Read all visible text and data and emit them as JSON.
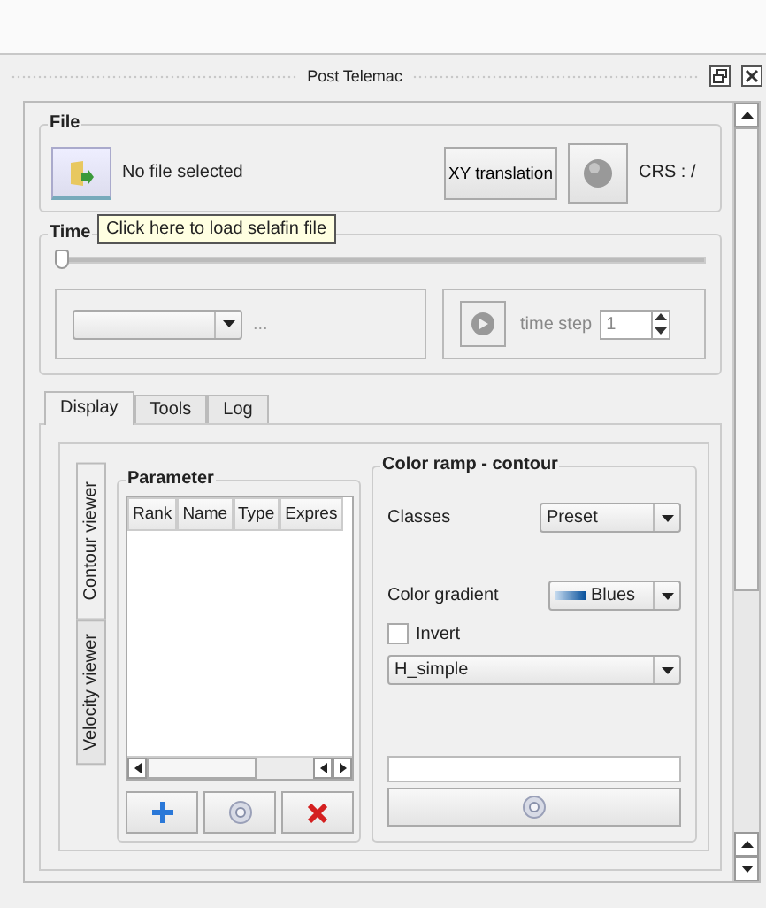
{
  "dock": {
    "title": "Post Telemac"
  },
  "file": {
    "title": "File",
    "status": "No file selected",
    "xy_button": "XY translation",
    "crs": "CRS : /",
    "tooltip": "Click here to load selafin file"
  },
  "time": {
    "title": "Time",
    "slider": {
      "level": 0
    },
    "dropdown_suffix": "...",
    "time_step_label": "time step",
    "time_step": "1"
  },
  "tabs": [
    {
      "label": "Display",
      "selected": true
    },
    {
      "label": "Tools",
      "selected": false
    },
    {
      "label": "Log",
      "selected": false
    }
  ],
  "side_tabs": [
    {
      "label": "Contour viewer",
      "selected": true
    },
    {
      "label": "Velocity viewer",
      "selected": false
    }
  ],
  "parameter": {
    "title": "Parameter",
    "columns": [
      "Rank",
      "Name",
      "Type",
      "Expres"
    ]
  },
  "color_ramp": {
    "title": "Color ramp - contour",
    "classes_label": "Classes",
    "classes": "Preset",
    "gradient_label": "Color gradient",
    "gradient": "Blues",
    "invert": {
      "label": "Invert",
      "checked": false
    },
    "preset": "H_simple"
  }
}
